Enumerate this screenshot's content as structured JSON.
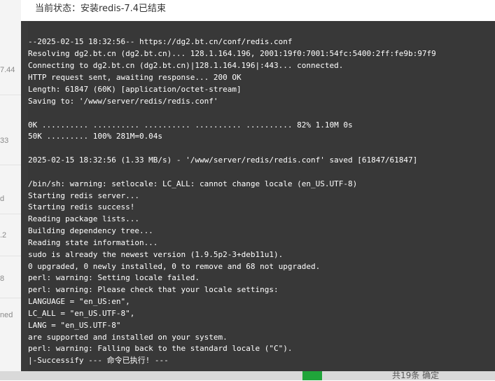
{
  "modal": {
    "title": "当前状态：安装redis-7.4已结束"
  },
  "terminal": {
    "lines": [
      "--2025-02-15 18:32:56-- https://dg2.bt.cn/conf/redis.conf",
      "Resolving dg2.bt.cn (dg2.bt.cn)... 128.1.164.196, 2001:19f0:7001:54fc:5400:2ff:fe9b:97f9",
      "Connecting to dg2.bt.cn (dg2.bt.cn)|128.1.164.196|:443... connected.",
      "HTTP request sent, awaiting response... 200 OK",
      "Length: 61847 (60K) [application/octet-stream]",
      "Saving to: '/www/server/redis/redis.conf'",
      "",
      "0K .......... .......... .......... .......... .......... 82% 1.10M 0s",
      "50K ......... 100% 281M=0.04s",
      "",
      "2025-02-15 18:32:56 (1.33 MB/s) - '/www/server/redis/redis.conf' saved [61847/61847]",
      "",
      "/bin/sh: warning: setlocale: LC_ALL: cannot change locale (en_US.UTF-8)",
      "Starting redis server...",
      "Starting redis success!",
      "Reading package lists...",
      "Building dependency tree...",
      "Reading state information...",
      "sudo is already the newest version (1.9.5p2-3+deb11u1).",
      "0 upgraded, 0 newly installed, 0 to remove and 68 not upgraded.",
      "perl: warning: Setting locale failed.",
      "perl: warning: Please check that your locale settings:",
      "LANGUAGE = \"en_US:en\",",
      "LC_ALL = \"en_US.UTF-8\",",
      "LANG = \"en_US.UTF-8\"",
      "are supported and installed on your system.",
      "perl: warning: Falling back to the standard locale (\"C\").",
      "|-Successify --- 命令已执行! ---"
    ]
  },
  "background": {
    "left_fragments": [
      "7.44",
      "33",
      "d",
      ".2",
      "8",
      "ned"
    ],
    "bottom_text": "共19条 确定"
  },
  "colors": {
    "terminal_bg": "#383838",
    "terminal_text": "#ffffff",
    "header_bg": "#ffffff",
    "accent_green": "#20a53a"
  }
}
